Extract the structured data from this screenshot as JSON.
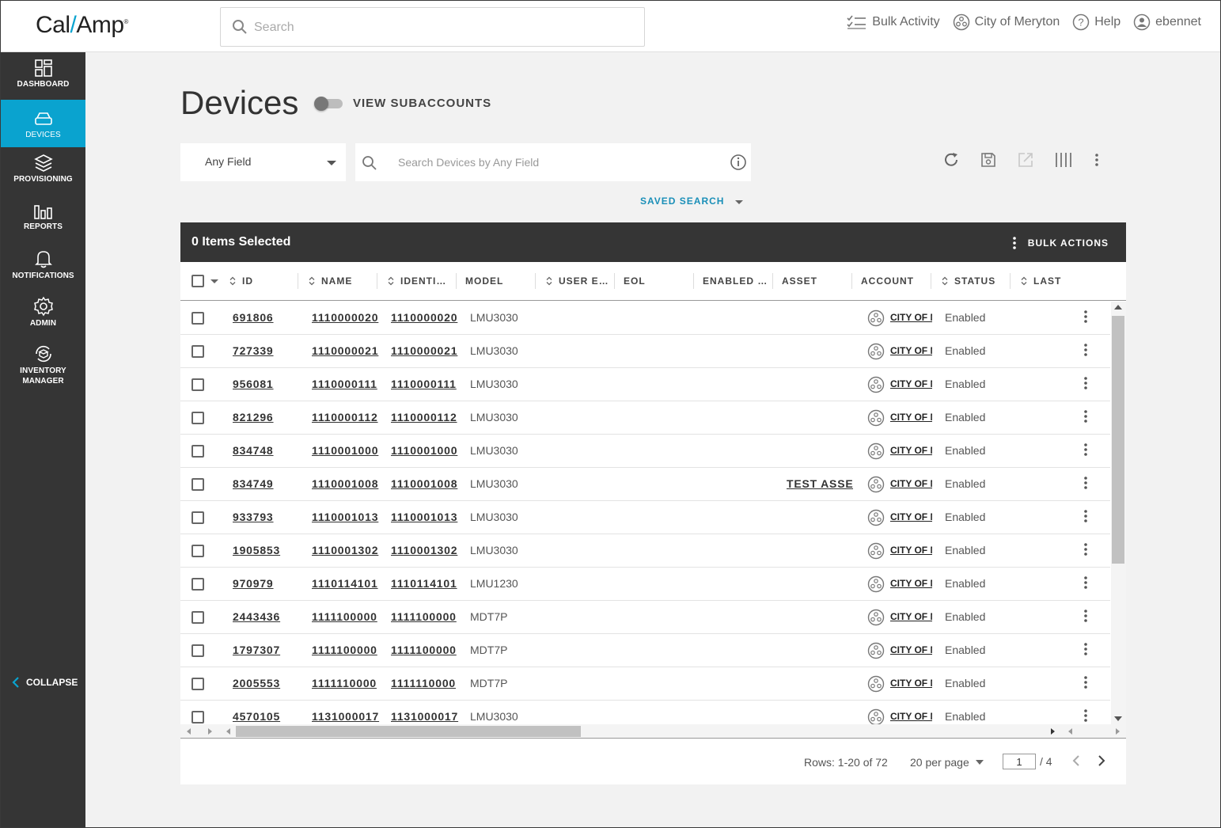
{
  "brand": {
    "logo_left": "Cal",
    "logo_slash": "/",
    "logo_right": "Amp",
    "logo_mark": "®"
  },
  "header": {
    "search_placeholder": "Search",
    "bulk_activity": "Bulk Activity",
    "account": "City of Meryton",
    "help": "Help",
    "user": "ebennet"
  },
  "sidebar": {
    "items": [
      {
        "label": "DASHBOARD",
        "icon": "dashboard-icon"
      },
      {
        "label": "DEVICES",
        "icon": "devices-icon",
        "active": true
      },
      {
        "label": "PROVISIONING",
        "icon": "layers-icon"
      },
      {
        "label": "REPORTS",
        "icon": "bar-chart-icon"
      },
      {
        "label": "NOTIFICATIONS",
        "icon": "bell-icon"
      },
      {
        "label": "ADMIN",
        "icon": "gear-icon"
      },
      {
        "label": "INVENTORY",
        "label2": "MANAGER",
        "icon": "inventory-icon"
      }
    ],
    "collapse": "COLLAPSE"
  },
  "page": {
    "title": "Devices",
    "view_subaccounts": "VIEW SUBACCOUNTS",
    "view_subaccounts_on": false,
    "field_select": "Any Field",
    "device_search_placeholder": "Search Devices by Any Field",
    "saved_search": "SAVED SEARCH"
  },
  "table": {
    "selected_label": "0 Items Selected",
    "bulk_actions": "BULK ACTIONS",
    "columns": [
      "ID",
      "NAME",
      "IDENTI…",
      "MODEL",
      "USER E…",
      "EOL",
      "ENABLED …",
      "ASSET",
      "ACCOUNT",
      "STATUS",
      "LAST"
    ],
    "rows": [
      {
        "id": "691806",
        "name": "1110000020",
        "ident": "1110000020",
        "model": "LMU3030",
        "asset": "",
        "account": "CITY OF MERYTON",
        "status": "Enabled"
      },
      {
        "id": "727339",
        "name": "1110000021",
        "ident": "1110000021",
        "model": "LMU3030",
        "asset": "",
        "account": "CITY OF MERYTON",
        "status": "Enabled"
      },
      {
        "id": "956081",
        "name": "1110000111",
        "ident": "1110000111",
        "model": "LMU3030",
        "asset": "",
        "account": "CITY OF MERYTON",
        "status": "Enabled"
      },
      {
        "id": "821296",
        "name": "1110000112",
        "ident": "1110000112",
        "model": "LMU3030",
        "asset": "",
        "account": "CITY OF MERYTON",
        "status": "Enabled"
      },
      {
        "id": "834748",
        "name": "1110001000",
        "ident": "1110001000",
        "model": "LMU3030",
        "asset": "",
        "account": "CITY OF MERYTON",
        "status": "Enabled"
      },
      {
        "id": "834749",
        "name": "1110001008",
        "ident": "1110001008",
        "model": "LMU3030",
        "asset": "TEST ASSET",
        "account": "CITY OF MERYTON",
        "status": "Enabled"
      },
      {
        "id": "933793",
        "name": "1110001013",
        "ident": "1110001013",
        "model": "LMU3030",
        "asset": "",
        "account": "CITY OF MERYTON",
        "status": "Enabled"
      },
      {
        "id": "1905853",
        "name": "1110001302",
        "ident": "1110001302",
        "model": "LMU3030",
        "asset": "",
        "account": "CITY OF MERYTON",
        "status": "Enabled"
      },
      {
        "id": "970979",
        "name": "1110114101",
        "ident": "1110114101",
        "model": "LMU1230",
        "asset": "",
        "account": "CITY OF MERYTON",
        "status": "Enabled"
      },
      {
        "id": "2443436",
        "name": "1111100000",
        "ident": "1111100000",
        "model": "MDT7P",
        "asset": "",
        "account": "CITY OF MERYTON",
        "status": "Enabled"
      },
      {
        "id": "1797307",
        "name": "1111100000",
        "ident": "1111100000",
        "model": "MDT7P",
        "asset": "",
        "account": "CITY OF MERYTON",
        "status": "Enabled"
      },
      {
        "id": "2005553",
        "name": "1111110000",
        "ident": "1111110000",
        "model": "MDT7P",
        "asset": "",
        "account": "CITY OF MERYTON",
        "status": "Enabled"
      },
      {
        "id": "4570105",
        "name": "1131000017",
        "ident": "1131000017",
        "model": "LMU3030",
        "asset": "",
        "account": "CITY OF MERYTON",
        "status": "Enabled"
      }
    ]
  },
  "pagination": {
    "rows_info": "Rows: 1-20 of 72",
    "per_page": "20 per page",
    "current_page": "1",
    "total_pages": "/ 4"
  },
  "colors": {
    "accent": "#0aa3cf",
    "sidebar": "#353535",
    "selbar": "#353535"
  }
}
